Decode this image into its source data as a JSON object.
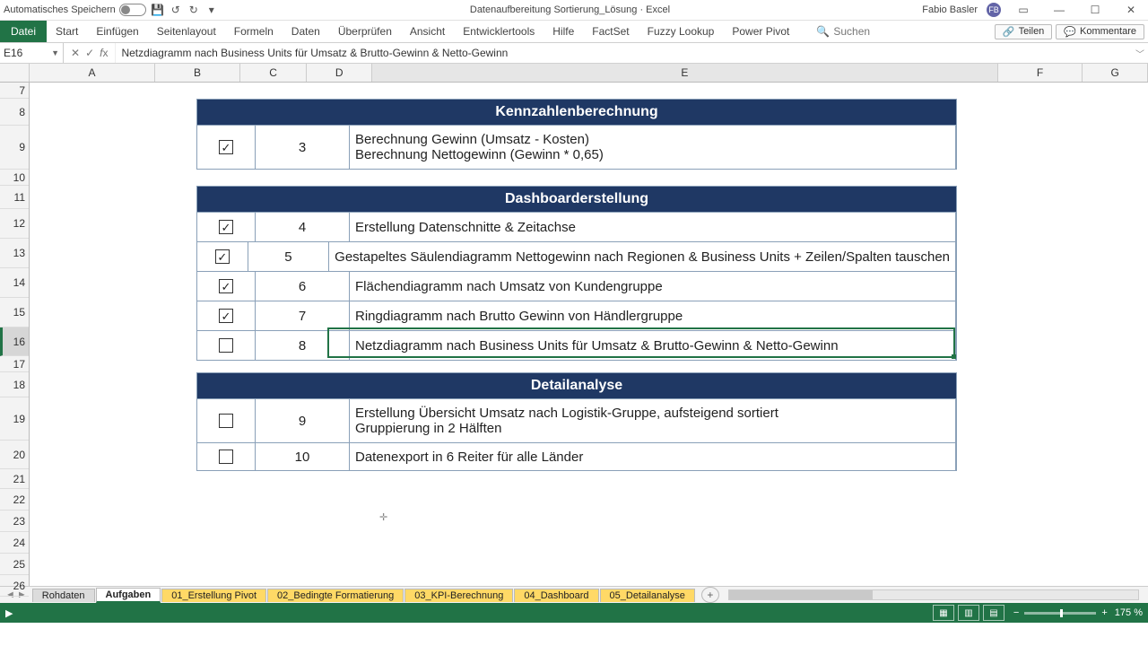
{
  "titlebar": {
    "autosave": "Automatisches Speichern",
    "doc_title": "Datenaufbereitung Sortierung_Lösung  ·  Excel",
    "user": "Fabio Basler",
    "avatar": "FB"
  },
  "ribbon": {
    "file": "Datei",
    "tabs": [
      "Start",
      "Einfügen",
      "Seitenlayout",
      "Formeln",
      "Daten",
      "Überprüfen",
      "Ansicht",
      "Entwicklertools",
      "Hilfe",
      "FactSet",
      "Fuzzy Lookup",
      "Power Pivot"
    ],
    "search_placeholder": "Suchen",
    "share": "Teilen",
    "comments": "Kommentare"
  },
  "formula_bar": {
    "cell_ref": "E16",
    "formula": "Netzdiagramm nach Business Units für Umsatz & Brutto-Gewinn & Netto-Gewinn"
  },
  "columns": [
    "A",
    "B",
    "C",
    "D",
    "E",
    "F",
    "G"
  ],
  "row_labels": [
    "7",
    "8",
    "9",
    "10",
    "11",
    "12",
    "13",
    "14",
    "15",
    "16",
    "17",
    "18",
    "19",
    "20",
    "21",
    "22",
    "23",
    "24",
    "25",
    "26"
  ],
  "selected_row_label": "16",
  "tables": {
    "kennzahlen": {
      "title": "Kennzahlenberechnung",
      "rows": [
        {
          "checked": true,
          "num": "3",
          "text1": "Berechnung Gewinn (Umsatz - Kosten)",
          "text2": "Berechnung Nettogewinn (Gewinn * 0,65)"
        }
      ]
    },
    "dashboard": {
      "title": "Dashboarderstellung",
      "rows": [
        {
          "checked": true,
          "num": "4",
          "text": "Erstellung Datenschnitte & Zeitachse"
        },
        {
          "checked": true,
          "num": "5",
          "text": "Gestapeltes Säulendiagramm Nettogewinn nach Regionen & Business Units + Zeilen/Spalten tauschen"
        },
        {
          "checked": true,
          "num": "6",
          "text": "Flächendiagramm nach Umsatz von Kundengruppe"
        },
        {
          "checked": true,
          "num": "7",
          "text": "Ringdiagramm nach Brutto Gewinn von Händlergruppe"
        },
        {
          "checked": false,
          "num": "8",
          "text": "Netzdiagramm nach Business Units für Umsatz & Brutto-Gewinn & Netto-Gewinn"
        }
      ]
    },
    "detail": {
      "title": "Detailanalyse",
      "rows": [
        {
          "checked": false,
          "num": "9",
          "text1": "Erstellung Übersicht Umsatz nach Logistik-Gruppe, aufsteigend sortiert",
          "text2": "Gruppierung in 2 Hälften"
        },
        {
          "checked": false,
          "num": "10",
          "text": "Datenexport in 6 Reiter für alle Länder"
        }
      ]
    }
  },
  "sheets": {
    "items": [
      {
        "label": "Rohdaten",
        "cls": "grey"
      },
      {
        "label": "Aufgaben",
        "cls": "active"
      },
      {
        "label": "01_Erstellung Pivot",
        "cls": "yellow"
      },
      {
        "label": "02_Bedingte Formatierung",
        "cls": "yellow"
      },
      {
        "label": "03_KPI-Berechnung",
        "cls": "yellow"
      },
      {
        "label": "04_Dashboard",
        "cls": "yellow"
      },
      {
        "label": "05_Detailanalyse",
        "cls": "yellow"
      }
    ]
  },
  "status": {
    "zoom": "175 %"
  }
}
